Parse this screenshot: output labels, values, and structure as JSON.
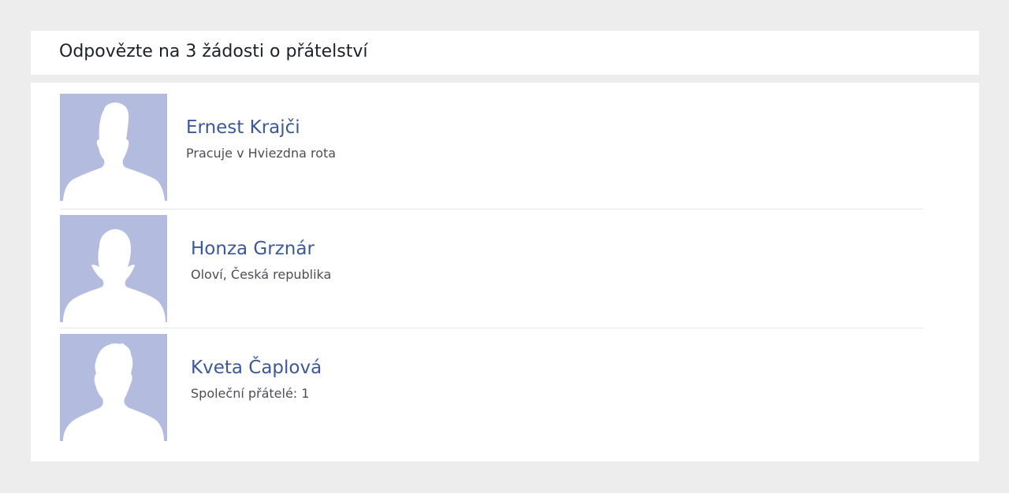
{
  "header": {
    "title": "Odpovězte na 3 žádosti o přátelství"
  },
  "requests": [
    {
      "name": "Ernest Krajči",
      "detail": "Pracuje v Hviezdna rota",
      "avatar_icon": "default-male-silhouette-icon"
    },
    {
      "name": "Honza Grznár",
      "detail": "Oloví, Česká republika",
      "avatar_icon": "default-male-silhouette-icon"
    },
    {
      "name": "Kveta Čaplová",
      "detail": "Společní přátelé: 1",
      "avatar_icon": "default-female-silhouette-icon"
    }
  ],
  "colors": {
    "page_background": "#ededed",
    "card_background": "#ffffff",
    "avatar_background": "#b3bcdf",
    "silhouette": "#ffffff",
    "name_link": "#3b5998",
    "detail_text": "#4b4f56",
    "title_text": "#1d2129",
    "divider": "#e6e6e6"
  }
}
